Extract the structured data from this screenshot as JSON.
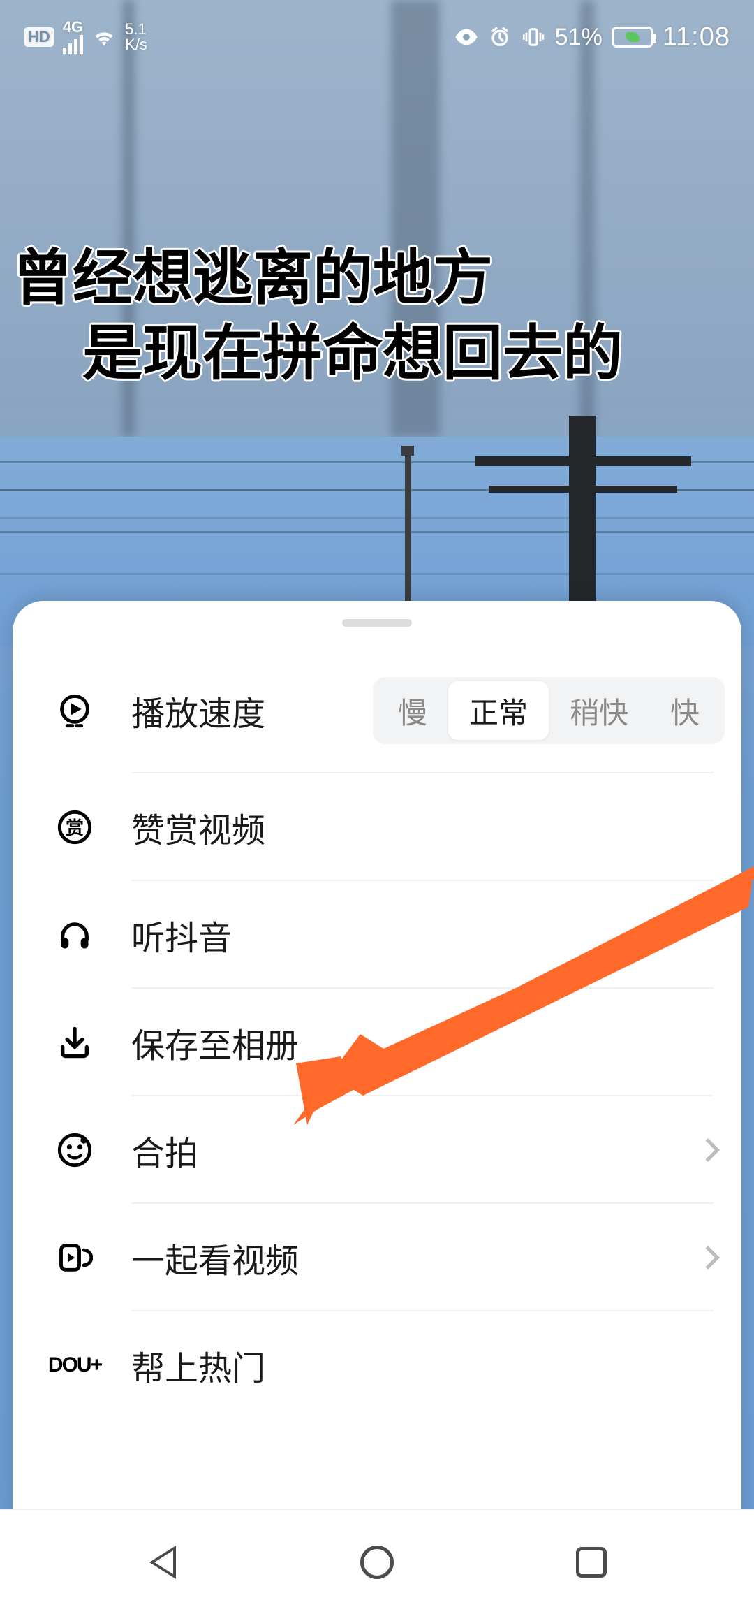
{
  "status": {
    "hd": "HD",
    "net_gen": "4G",
    "speed_top": "5.1",
    "speed_bot": "K/s",
    "battery_pct": "51%",
    "clock": "11:08"
  },
  "video": {
    "caption_line1": "曾经想逃离的地方",
    "caption_line2": "是现在拼命想回去的"
  },
  "sheet": {
    "playback_speed": {
      "label": "播放速度",
      "options": {
        "slow": "慢",
        "normal": "正常",
        "faster": "稍快",
        "fast": "快"
      },
      "selected": "normal"
    },
    "reward": {
      "label": "赞赏视频"
    },
    "listen": {
      "label": "听抖音"
    },
    "save": {
      "label": "保存至相册"
    },
    "duet": {
      "label": "合拍"
    },
    "watch_together": {
      "label": "一起看视频"
    },
    "dou_plus": {
      "icon_text": "DOU+",
      "label": "帮上热门"
    }
  },
  "annotation": {
    "color": "#ff6a2b",
    "target": "save"
  }
}
